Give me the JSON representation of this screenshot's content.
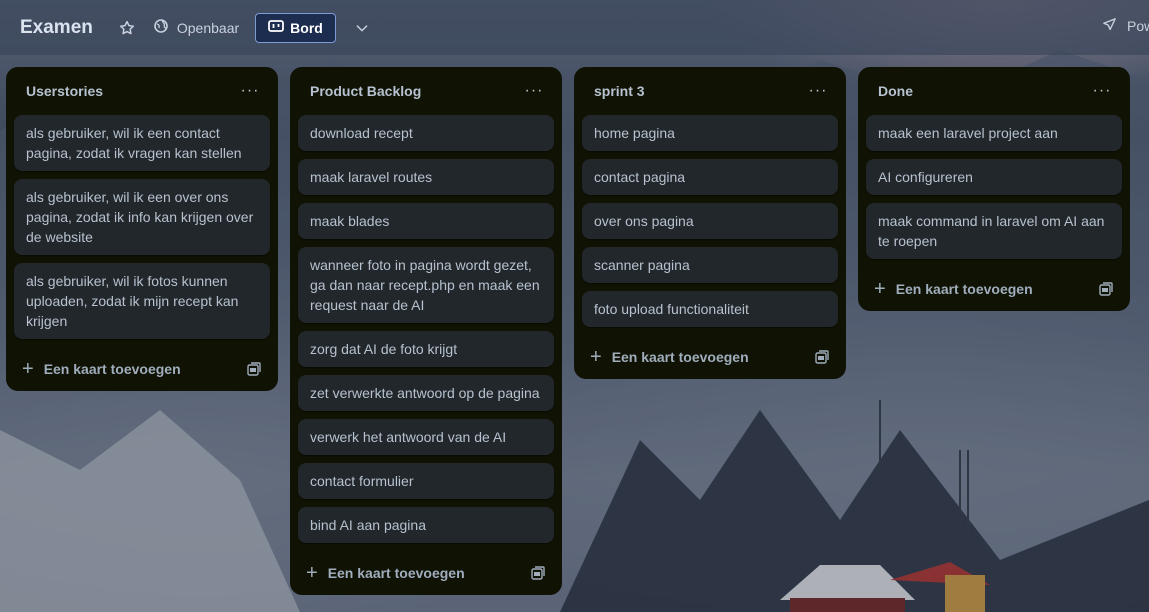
{
  "header": {
    "board_title": "Examen",
    "visibility_label": "Openbaar",
    "view_label": "Bord",
    "power_ups_label": "Power-Ups"
  },
  "lists": [
    {
      "title": "Userstories",
      "cards": [
        "als gebruiker, wil ik een contact pagina, zodat ik vragen kan stellen",
        "als gebruiker, wil ik een over ons pagina, zodat ik info kan krijgen over de website",
        "als gebruiker, wil ik fotos kunnen uploaden, zodat ik mijn recept kan krijgen"
      ],
      "add_label": "Een kaart toevoegen"
    },
    {
      "title": "Product Backlog",
      "cards": [
        "download recept",
        "maak laravel routes",
        "maak blades",
        "wanneer foto in pagina wordt gezet, ga dan naar recept.php en maak een request naar de AI",
        "zorg dat AI de foto krijgt",
        "zet verwerkte antwoord op de pagina",
        "verwerk het antwoord van de AI",
        "contact formulier",
        "bind AI aan pagina"
      ],
      "add_label": "Een kaart toevoegen"
    },
    {
      "title": "sprint 3",
      "cards": [
        "home pagina",
        "contact pagina",
        "over ons pagina",
        "scanner pagina",
        "foto upload functionaliteit"
      ],
      "add_label": "Een kaart toevoegen"
    },
    {
      "title": "Done",
      "cards": [
        "maak een laravel project aan",
        "AI configureren",
        "maak command in laravel om AI aan te roepen"
      ],
      "add_label": "Een kaart toevoegen"
    }
  ],
  "icons": {
    "star": "star-icon",
    "visibility": "globe-icon",
    "view": "board-icon",
    "chevron": "chevron-down-icon",
    "power_ups": "rocket-icon",
    "list_menu": "more-icon",
    "add": "plus-icon",
    "template": "template-icon"
  },
  "colors": {
    "list_bg": "#101204",
    "card_bg": "#22272b",
    "card_text": "#b6c2cf",
    "view_button_bg": "#1d2d4f"
  }
}
